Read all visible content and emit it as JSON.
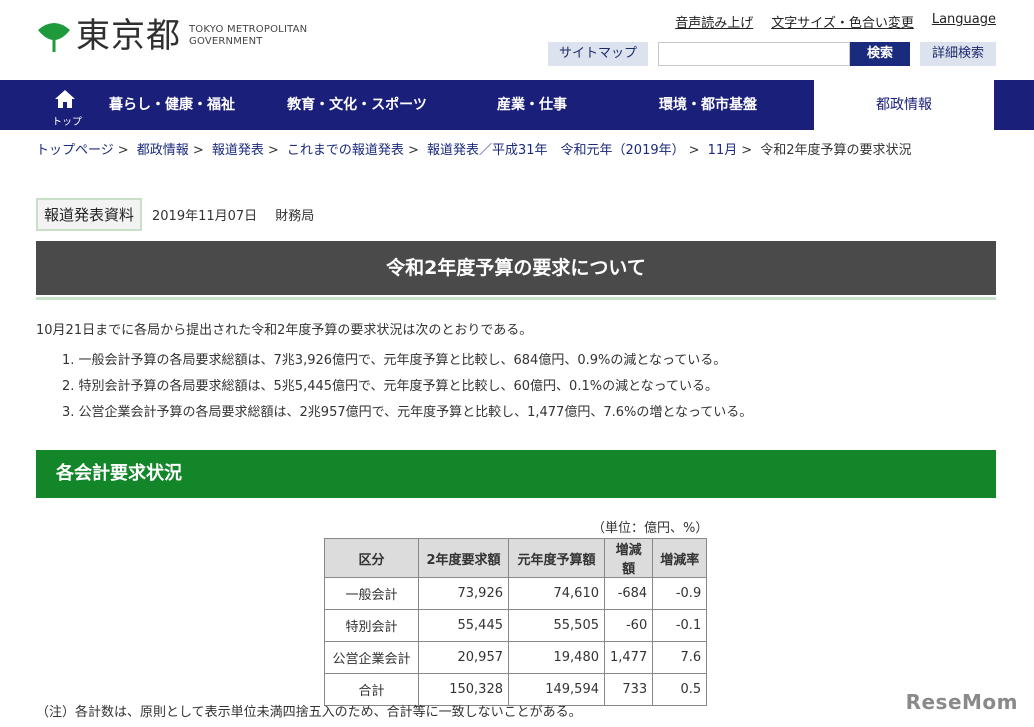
{
  "header": {
    "logo_kanji": "東京都",
    "logo_en_line1": "TOKYO METROPOLITAN",
    "logo_en_line2": "GOVERNMENT",
    "util_links": [
      "音声読み上げ",
      "文字サイズ・色合い変更",
      "Language"
    ],
    "sitemap_label": "サイトマップ",
    "search_placeholder": "",
    "search_button": "検索",
    "advanced_search_label": "詳細検索"
  },
  "nav": {
    "home_label": "トップ",
    "items": [
      "暮らし・健康・福祉",
      "教育・文化・スポーツ",
      "産業・仕事",
      "環境・都市基盤",
      "都政情報"
    ]
  },
  "breadcrumb": [
    "トップページ",
    "都政情報",
    "報道発表",
    "これまでの報道発表",
    "報道発表／平成31年　令和元年（2019年）",
    "11月",
    "令和2年度予算の要求状況"
  ],
  "press": {
    "tag": "報道発表資料",
    "date": "2019年11月07日",
    "dept": "財務局"
  },
  "title": "令和2年度予算の要求について",
  "intro": "10月21日までに各局から提出された令和2年度予算の要求状況は次のとおりである。",
  "list": [
    "1. 一般会計予算の各局要求総額は、7兆3,926億円で、元年度予算と比較し、684億円、0.9%の減となっている。",
    "2. 特別会計予算の各局要求総額は、5兆5,445億円で、元年度予算と比較し、60億円、0.1%の減となっている。",
    "3. 公営企業会計予算の各局要求総額は、2兆957億円で、元年度予算と比較し、1,477億円、7.6%の増となっている。"
  ],
  "section_title": "各会計要求状況",
  "table": {
    "unit": "（単位：億円、%）",
    "headers": [
      "区分",
      "2年度要求額",
      "元年度予算額",
      "増減額",
      "増減率"
    ],
    "rows": [
      [
        "一般会計",
        "73,926",
        "74,610",
        "-684",
        "-0.9"
      ],
      [
        "特別会計",
        "55,445",
        "55,505",
        "-60",
        "-0.1"
      ],
      [
        "公営企業会計",
        "20,957",
        "19,480",
        "1,477",
        "7.6"
      ],
      [
        "合計",
        "150,328",
        "149,594",
        "733",
        "0.5"
      ]
    ]
  },
  "note": "（注）各計数は、原則として表示単位未満四捨五入のため、合計等に一致しないことがある。",
  "watermark": "ReseMom",
  "colors": {
    "nav_bg": "#1a1f7a",
    "title_bg": "#4a4a4a",
    "section_bg": "#14862a",
    "logo_green": "#1e9a3a"
  }
}
